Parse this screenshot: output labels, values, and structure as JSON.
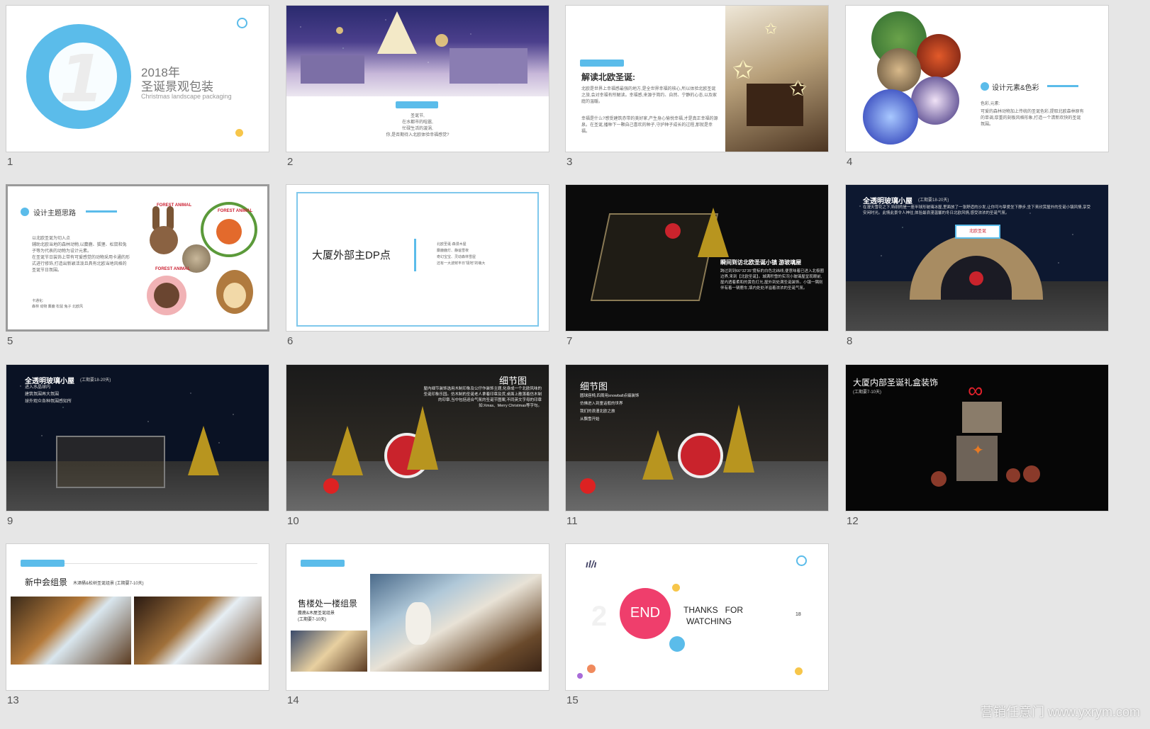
{
  "slide_numbers": [
    "1",
    "2",
    "3",
    "4",
    "5",
    "6",
    "7",
    "8",
    "9",
    "10",
    "11",
    "12",
    "13",
    "14",
    "15"
  ],
  "s1": {
    "big_digit": "1",
    "year": "2018年",
    "title": "圣诞景观包装",
    "subtitle": "Christmas landscape packaging"
  },
  "s2": {
    "lines": [
      "圣诞节,",
      "在水都市的喧嚣,",
      "忙碌生活的漩涡,",
      "你,是否期待入北欧体验幸福感觉?"
    ]
  },
  "s3": {
    "heading": "解读北欧圣诞:",
    "p1": "北欧是世界上幸福感最强的地方,是全世界幸福的核心,所以体验北欧圣诞之旅,会对幸福有所解读。幸福感,来源于简约、自然、宁静的心态,以及家庭的温暖。",
    "p2": "幸福是什么?感受建筑赤带的美好家,产生身心愉悦幸福,才是真正幸福的源泉。在圣诞,播种下一颗自己喜欢的种子,守护种子成长的过程,那就是幸福。"
  },
  "s4": {
    "heading": "设计元素&色彩",
    "label": "色彩,元素:",
    "body": "可爱的森林动物加上传统的圣诞色彩,提取北欧森林原有的单调,厚重的刻板风格形象,打造一个清新欢快的圣诞氛围。"
  },
  "s5": {
    "heading": "设计主题思路",
    "body": "以北欧圣诞为切入点\n辅助北欧当地的森林动物,以麋鹿、狐狸、松鼠和兔子等为代表的动物为设计元素。\n在圣诞节日装饰上带有可爱感觉的动物采用卡通的形式进行修饰,打造出新颖活泼且具有北欧当地风格的圣诞节日氛围。",
    "footer_label": "卡通化:",
    "footer": "森林 动物 麋鹿 松鼠 兔子 北欧风",
    "card_label": "FOREST ANIMAL"
  },
  "s6": {
    "title": "大厦外部主DP点",
    "lines": [
      "北欧圣诞·森漫木屋",
      "麋鹿鹿灯、静谧雪夜",
      "奇幻宝宝、灵动森林雪屋",
      "还有一大波鲜丰日“极地”的萌大"
    ]
  },
  "s7": {
    "heading": "瞬间到访北欧圣诞小镇 游玻璃屋",
    "body": "跨过到到66°32′35″度标的白色北纬线,便意味着已进入北极圈边界,来到【北欧圣诞】。城满积雪的实况小玻璃屋呈现眼前,屋内透着柔和的黄色灯光,屋外到处满圣诞装饰。小镇一隅则伴有着一辆鹿车,填内处处洋溢着浓浓的圣诞气氛。"
  },
  "s8": {
    "heading": "全透明玻璃小屋",
    "period": "(工期要18-20天)",
    "body": "在漫天雪花之下,特别的是一座半球形玻璃冰屋,里面放了一张舒适的沙发,让你可与挚爱坐下静步,坐下来欣赏屋外的圣诞小镇风情,享受安闲时光。此情此景令人神往,体验最浪漫温馨的冬日北欧风情,感受浓浓的圣诞气氛。",
    "sign": "北欧圣诞"
  },
  "s9": {
    "heading": "全透明玻璃小屋",
    "period": "(工期要18-20天)",
    "lines": [
      "进入水晶球内",
      "建筑氛围再大氛围",
      "球外观众各种氛围感知所"
    ]
  },
  "s10": {
    "heading": "细节图",
    "body": "屋内细节装饰选用木制印象及公仔作装饰主题,化身成一个北欧风味的圣诞印象乐园。仿木制的圣诞老人拿着印章及货,桌面上散落着仿木制的印章,当中包括迎合气氛的圣诞节图案,不同英文字母的印章如:Xmas、Merry Christmas等字句。"
  },
  "s11": {
    "heading": "细节图",
    "lines": [
      "圆球座椅,四周用snowball点缀装饰",
      "仿佛进入到童话般的世界",
      "我们的浪漫北欧之旅",
      "从飘雪开始"
    ]
  },
  "s12": {
    "heading": "大厦内部圣诞礼盒装饰",
    "period": "(工期要7-10天)"
  },
  "s13": {
    "heading": "新中会组景",
    "sub": "木酒桶&松树圣诞组景 (工期要7-10天)"
  },
  "s14": {
    "heading": "售楼处一楼组景",
    "sub": "麋鹿&木屋圣诞组景",
    "period": "(工期要7-10天)"
  },
  "s15": {
    "end": "END",
    "thanks_line1": "THANKS   FOR",
    "thanks_line2": "WATCHING",
    "page": "18",
    "ghost_digit": "2",
    "logo": "ıl/ı"
  },
  "watermark": "营销任意门 www.yxrym.com",
  "colors": {
    "accent_blue": "#5bbcea",
    "pink": "#ef3e6c",
    "yellow": "#f7c64a",
    "background": "#e6e6e6"
  }
}
